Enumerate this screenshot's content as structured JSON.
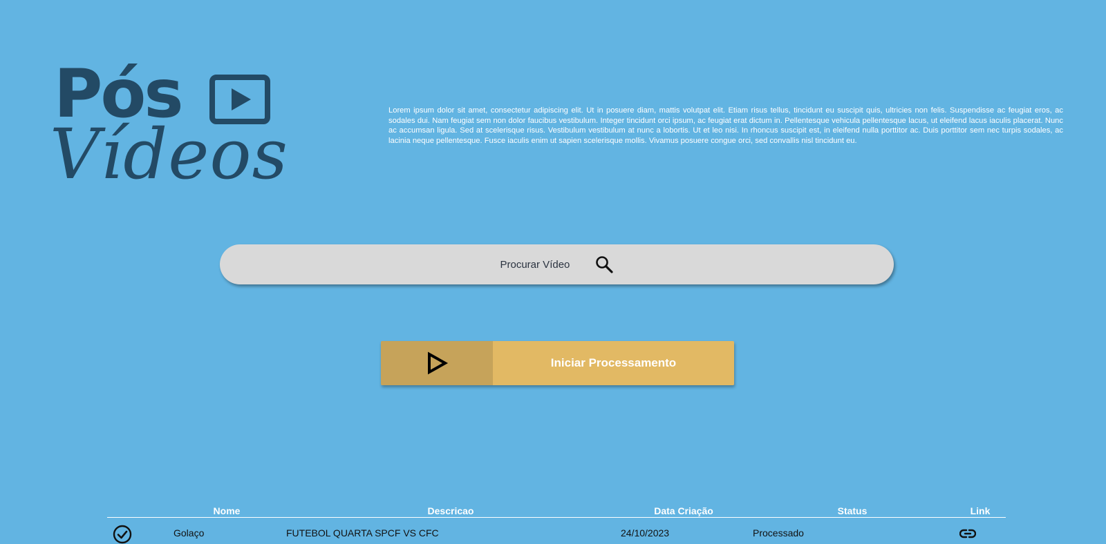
{
  "logo": {
    "line1": "Pós",
    "line2": "Vídeos",
    "icon": "play-square-icon",
    "color": "#234a65"
  },
  "description": "Lorem ipsum dolor sit amet, consectetur adipiscing elit. Ut in posuere diam, mattis volutpat elit. Etiam risus tellus, tincidunt eu suscipit quis, ultricies non felis. Suspendisse ac feugiat eros, ac sodales dui. Nam feugiat sem non dolor faucibus vestibulum. Integer tincidunt orci ipsum, ac feugiat erat dictum in. Pellentesque vehicula pellentesque lacus, ut eleifend lacus iaculis placerat. Nunc ac accumsan ligula. Sed at scelerisque risus. Vestibulum vestibulum at nunc a lobortis. Ut et leo nisi. In rhoncus suscipit est, in eleifend nulla porttitor ac. Duis porttitor sem nec turpis sodales, ac lacinia neque pellentesque. Fusce iaculis enim ut sapien scelerisque mollis. Vivamus posuere congue orci, sed convallis nisl tincidunt eu.",
  "search": {
    "placeholder": "Procurar Vídeo",
    "value": "",
    "icon": "search-icon"
  },
  "process_button": {
    "label": "Iniciar Processamento",
    "icon": "play-outline-icon",
    "color_dark": "#c6a35a",
    "color_light": "#e2b964"
  },
  "table": {
    "headers": {
      "nome": "Nome",
      "descricao": "Descricao",
      "data": "Data Criação",
      "status": "Status",
      "link": "Link"
    },
    "rows": [
      {
        "nome": "Golaço",
        "descricao": "FUTEBOL QUARTA SPCF VS CFC",
        "data": "24/10/2023",
        "status": "Processado",
        "status_icon": "check-circle-icon",
        "link_icon": "link-icon"
      }
    ]
  },
  "colors": {
    "background": "#62b4e2",
    "search_bg": "#d9d9d9"
  }
}
